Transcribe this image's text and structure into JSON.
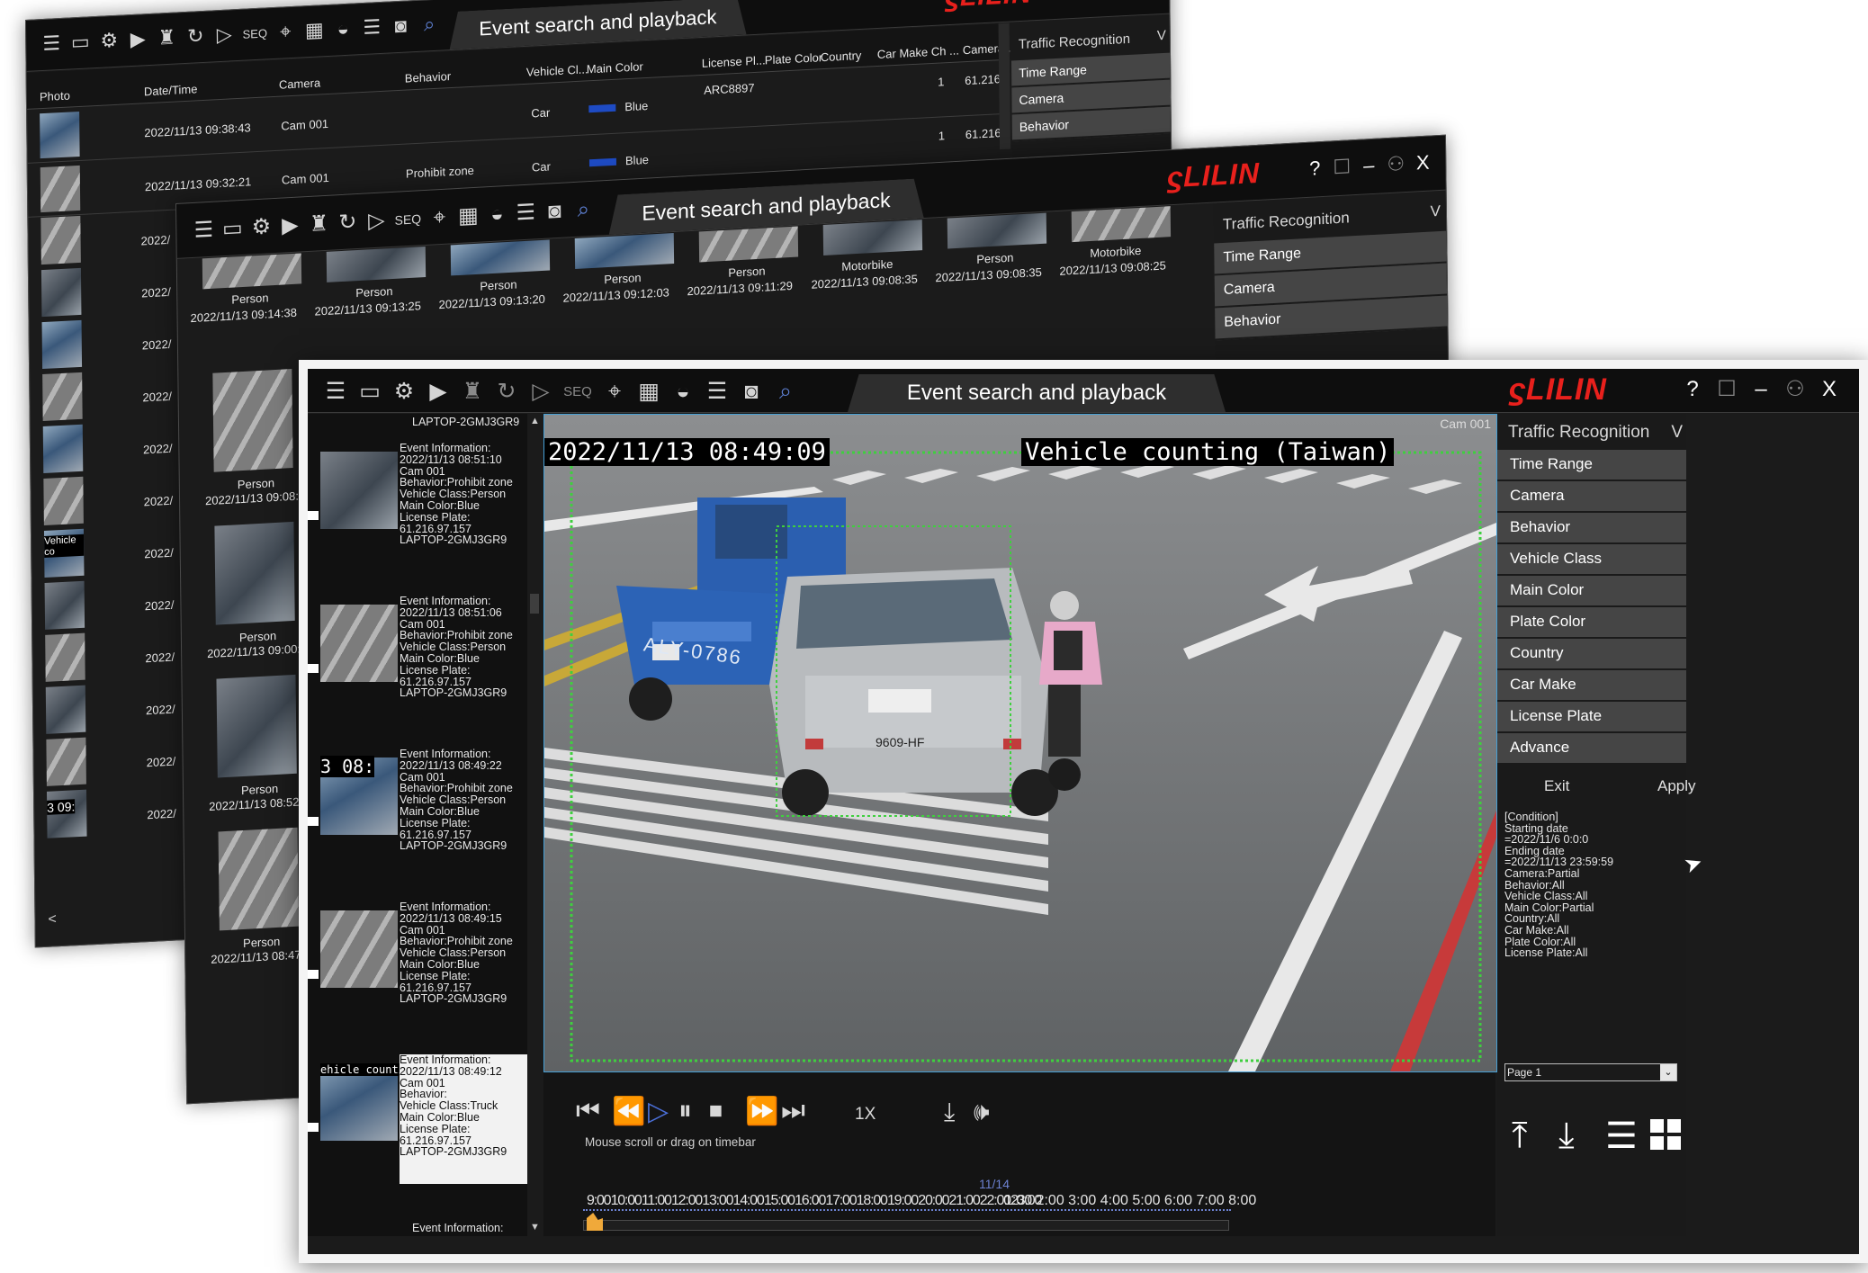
{
  "common": {
    "window_title": "Event search and playback",
    "logo": "LILIN",
    "seq_label": "SEQ",
    "controls": {
      "help": "?",
      "maximize": "☐",
      "minimize": "–",
      "user": "⚇",
      "close": "X"
    }
  },
  "right_panel": {
    "title": "Traffic Recognition",
    "chevron": "V",
    "items": [
      "Time Range",
      "Camera",
      "Behavior",
      "Vehicle Class",
      "Main Color",
      "Plate Color",
      "Country",
      "Car Make",
      "License Plate",
      "Advance"
    ],
    "exit_label": "Exit",
    "apply_label": "Apply",
    "condition_text": "[Condition]\nStarting date\n=2022/11/6 0:0:0\nEnding date\n=2022/11/13 23:59:59\nCamera:Partial\nBehavior:All\nVehicle Class:All\nMain Color:Partial\nCountry:All\nCar Make:All\nPlate Color:All\nLicense Plate:All",
    "page_select": "Page 1"
  },
  "back_window": {
    "columns": [
      "Photo",
      "Date/Time",
      "Camera",
      "Behavior",
      "Vehicle Cl...",
      "Main Color",
      "License Pl...",
      "Plate Color",
      "Country",
      "Car Make",
      "Ch ...",
      "Camera..."
    ],
    "rows": [
      {
        "datetime": "2022/11/13 09:38:43",
        "camera": "Cam 001",
        "behavior": "",
        "vehicle_class": "Car",
        "main_color": "Blue",
        "license_plate": "ARC8897",
        "ch": "1",
        "camera_ip": "61.216"
      },
      {
        "datetime": "2022/11/13 09:32:21",
        "camera": "Cam 001",
        "behavior": "Prohibit zone",
        "vehicle_class": "Car",
        "main_color": "Blue",
        "license_plate": "",
        "ch": "1",
        "camera_ip": "61.216"
      }
    ],
    "partial_dates": [
      "2022/",
      "2022/",
      "2022/",
      "2022/",
      "2022/",
      "2022/",
      "2022/",
      "2022/",
      "2022/",
      "2022/",
      "2022/",
      "2022/",
      "2022/",
      "2022/",
      "2022/"
    ],
    "thumb_overlay_1": "Vehicle co",
    "thumb_overlay_2": "3 09:",
    "scroll_left": "<"
  },
  "middle_window": {
    "grid_items": [
      {
        "type": "Person",
        "datetime": "2022/11/13 09:14:38"
      },
      {
        "type": "Person",
        "datetime": "2022/11/13 09:13:25"
      },
      {
        "type": "Person",
        "datetime": "2022/11/13 09:13:20"
      },
      {
        "type": "Person",
        "datetime": "2022/11/13 09:12:03"
      },
      {
        "type": "Person",
        "datetime": "2022/11/13 09:11:29"
      },
      {
        "type": "Motorbike",
        "datetime": "2022/11/13 09:08:35"
      },
      {
        "type": "Person",
        "datetime": "2022/11/13 09:08:35"
      },
      {
        "type": "Motorbike",
        "datetime": "2022/11/13 09:08:25"
      }
    ],
    "left_items": [
      {
        "type": "Person",
        "datetime": "2022/11/13 09:08:"
      },
      {
        "type": "Person",
        "datetime": "2022/11/13 09:00:"
      },
      {
        "type": "Person",
        "datetime": "2022/11/13 08:52:"
      },
      {
        "type": "Person",
        "datetime": "2022/11/13 08:47:"
      }
    ]
  },
  "front_window": {
    "sidebar_top_text": "LAPTOP-2GMJ3GR9",
    "events": [
      {
        "text": "Event Information:\n2022/11/13 08:51:10\nCam 001\nBehavior:Prohibit zone\nVehicle Class:Person\nMain Color:Blue\nLicense Plate:\n61.216.97.157\nLAPTOP-2GMJ3GR9",
        "overlay": ""
      },
      {
        "text": "Event Information:\n2022/11/13 08:51:06\nCam 001\nBehavior:Prohibit zone\nVehicle Class:Person\nMain Color:Blue\nLicense Plate:\n61.216.97.157\nLAPTOP-2GMJ3GR9",
        "overlay": ""
      },
      {
        "text": "Event Information:\n2022/11/13 08:49:22\nCam 001\nBehavior:Prohibit zone\nVehicle Class:Person\nMain Color:Blue\nLicense Plate:\n61.216.97.157\nLAPTOP-2GMJ3GR9",
        "overlay": "3 08:"
      },
      {
        "text": "Event Information:\n2022/11/13 08:49:15\nCam 001\nBehavior:Prohibit zone\nVehicle Class:Person\nMain Color:Blue\nLicense Plate:\n61.216.97.157\nLAPTOP-2GMJ3GR9",
        "overlay": ""
      },
      {
        "text": "Event Information:\n2022/11/13 08:49:12\nCam 001\nBehavior:\nVehicle Class:Truck\nMain Color:Blue\nLicense Plate:\n61.216.97.157\nLAPTOP-2GMJ3GR9",
        "overlay": "ehicle countin"
      }
    ],
    "last_event_partial": "Event Information:",
    "video": {
      "cam_label": "Cam 001",
      "timestamp": "2022/11/13 08:49:09",
      "caption": "Vehicle counting (Taiwan)",
      "truck_plate": "ALY-0786",
      "car_plate": "9609-HF"
    },
    "playback": {
      "speed": "1X",
      "hint": "Mouse scroll or drag on timebar",
      "date_marker": "11/14",
      "timeline": "9:00 10:00 11:00 12:00 13:00 14:00 15:00 16:00 17:00 18:00 19:00 20:00 21:00 22:00 23:00",
      "timeline_next": "1:00 2:00 3:00 4:00 5:00 6:00 7:00 8:00"
    }
  }
}
